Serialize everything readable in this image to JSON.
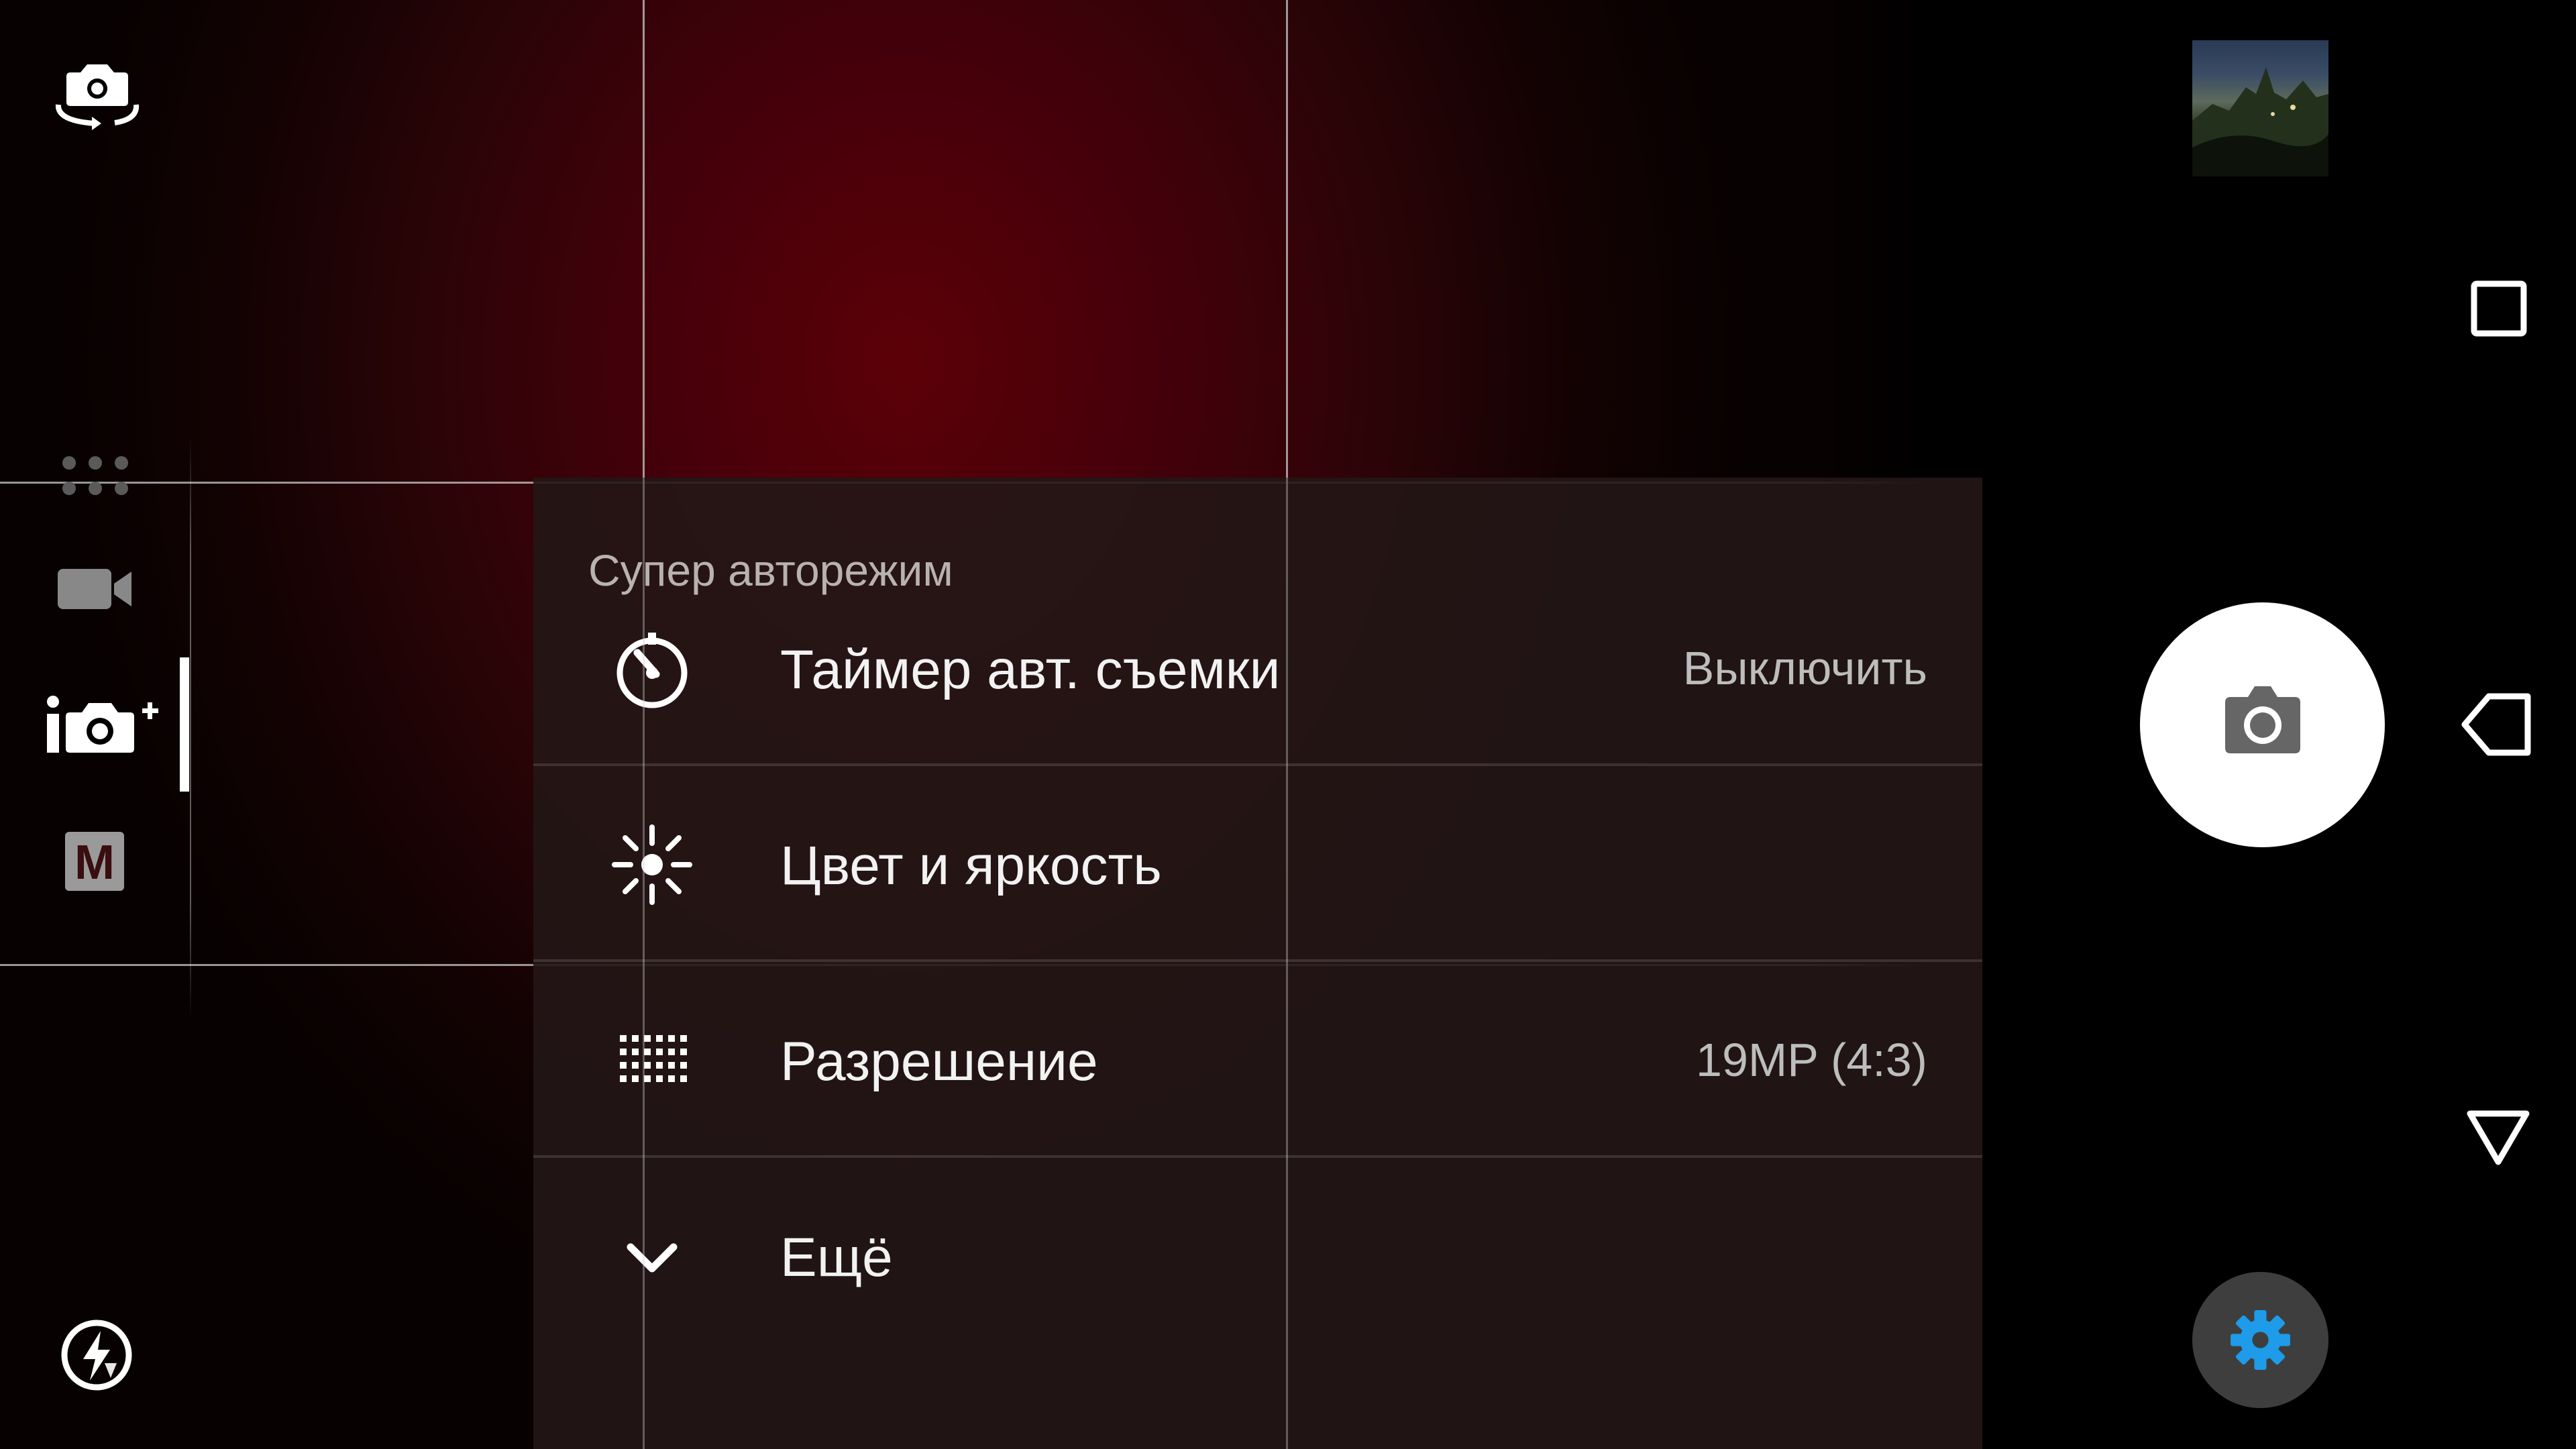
{
  "settings_panel": {
    "title": "Супер авторежим",
    "rows": [
      {
        "icon": "self-timer-icon",
        "label": "Таймер авт. съемки",
        "value": "Выключить"
      },
      {
        "icon": "brightness-icon",
        "label": "Цвет и яркость",
        "value": ""
      },
      {
        "icon": "resolution-grid-icon",
        "label": "Разрешение",
        "value": "19MP (4:3)"
      },
      {
        "icon": "chevron-down-icon",
        "label": "Ещё",
        "value": ""
      }
    ]
  },
  "left_rail": {
    "top_icon": "switch-camera-icon",
    "modes": [
      "more-modes-icon",
      "video-camera-icon",
      "superior-auto-icon",
      "manual-mode-icon"
    ],
    "selected_mode": "superior-auto-icon",
    "manual_mode_label": "M",
    "bottom_icon": "flash-auto-icon"
  },
  "right_controls": {
    "gallery_thumbnail": "gallery-thumbnail",
    "shutter": "camera-icon",
    "settings": "gear-icon"
  },
  "navigation_bar": [
    "recents-square-icon",
    "back-icon",
    "home-triangle-icon"
  ],
  "colors": {
    "viewfinder_red": "#5c0007",
    "panel_background": "#231616",
    "settings_gear_blue": "#1e9be9",
    "shutter_white": "#ffffff"
  }
}
